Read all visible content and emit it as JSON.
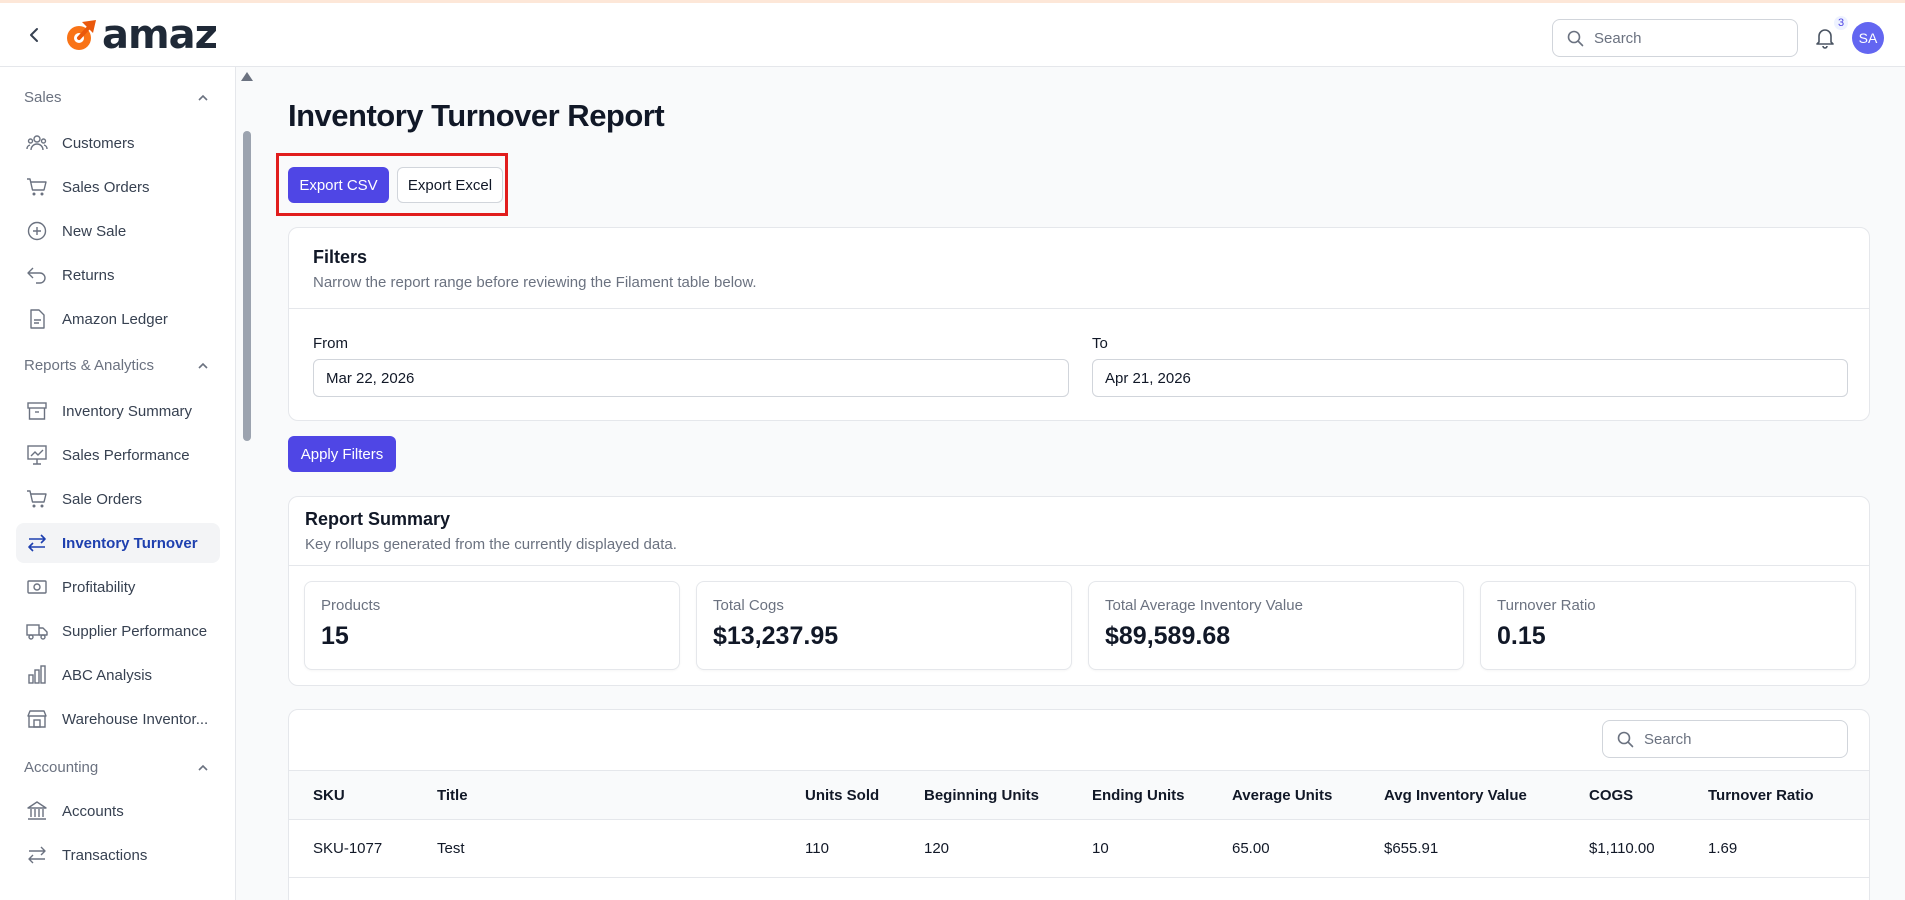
{
  "brand": {
    "name": "amaz",
    "logo_color": "#f97316"
  },
  "header": {
    "search_placeholder": "Search",
    "notification_count": "3",
    "avatar_initials": "SA"
  },
  "sidebar": {
    "sections": [
      {
        "label": "Sales",
        "items": [
          "Customers",
          "Sales Orders",
          "New Sale",
          "Returns",
          "Amazon Ledger"
        ]
      },
      {
        "label": "Reports & Analytics",
        "items": [
          "Inventory Summary",
          "Sales Performance",
          "Sale Orders",
          "Inventory Turnover",
          "Profitability",
          "Supplier Performance",
          "ABC Analysis",
          "Warehouse Inventor..."
        ]
      },
      {
        "label": "Accounting",
        "items": [
          "Accounts",
          "Transactions"
        ]
      }
    ],
    "active_item": "Inventory Turnover"
  },
  "page": {
    "title": "Inventory Turnover Report",
    "export_csv_label": "Export CSV",
    "export_excel_label": "Export Excel"
  },
  "filters": {
    "title": "Filters",
    "subtitle": "Narrow the report range before reviewing the Filament table below.",
    "from_label": "From",
    "from_value": "Mar 22, 2026",
    "to_label": "To",
    "to_value": "Apr 21, 2026",
    "apply_label": "Apply Filters"
  },
  "summary": {
    "title": "Report Summary",
    "subtitle": "Key rollups generated from the currently displayed data.",
    "stats": [
      {
        "label": "Products",
        "value": "15"
      },
      {
        "label": "Total Cogs",
        "value": "$13,237.95"
      },
      {
        "label": "Total Average Inventory Value",
        "value": "$89,589.68"
      },
      {
        "label": "Turnover Ratio",
        "value": "0.15"
      }
    ]
  },
  "table": {
    "search_placeholder": "Search",
    "columns": [
      "SKU",
      "Title",
      "Units Sold",
      "Beginning Units",
      "Ending Units",
      "Average Units",
      "Avg Inventory Value",
      "COGS",
      "Turnover Ratio"
    ],
    "rows": [
      [
        "SKU-1077",
        "Test",
        "110",
        "120",
        "10",
        "65.00",
        "$655.91",
        "$1,110.00",
        "1.69"
      ]
    ]
  },
  "colors": {
    "accent": "#4f46e5",
    "highlight": "#e11d1d"
  }
}
